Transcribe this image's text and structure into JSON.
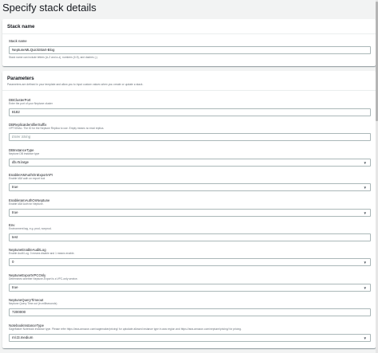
{
  "page_title": "Specify stack details",
  "stack_name_panel": {
    "title": "Stack name",
    "field_label": "Stack name",
    "value": "NeptuneMLQuickStart-Blog",
    "hint": "Stack name can include letters (A-Z and a-z), numbers (0-9), and dashes (-)."
  },
  "parameters_panel": {
    "title": "Parameters",
    "description": "Parameters are defined in your template and allow you to input custom values when you create or update a stack.",
    "fields": [
      {
        "label": "DBClusterPort",
        "desc": "Enter the port of your Neptune cluster",
        "value": "8182",
        "type": "input"
      },
      {
        "label": "DBReplicaIdentifierSuffix",
        "desc": "OPTIONAL: The ID for the Neptune Replica to use. Empty means no read replica.",
        "value": "",
        "placeholder": "Enter String",
        "type": "input"
      },
      {
        "label": "DBInstanceType",
        "desc": "Neptune DB instance type",
        "value": "db.r5.large",
        "type": "select"
      },
      {
        "label": "EnableIAMAuthOnExportAPI",
        "desc": "Enable IAM auth on export tool",
        "value": "true",
        "type": "select"
      },
      {
        "label": "EnableIamAuthOnNeptune",
        "desc": "Enable IAM Auth for Neptune.",
        "value": "true",
        "type": "select"
      },
      {
        "label": "Env",
        "desc": "Environment tag, e.g. prod, nonprod.",
        "value": "test",
        "type": "input"
      },
      {
        "label": "NeptuneEnableAuditLog",
        "desc": "Enable Audit Log. 0 means disable and 1 means enable.",
        "value": "0",
        "type": "select"
      },
      {
        "label": "NeptuneExportVPCOnly",
        "desc": "Determines whether Neptune-Export is a VPC-only service.",
        "value": "true",
        "type": "select"
      },
      {
        "label": "NeptuneQueryTimeout",
        "desc": "Neptune Query Time out (in milliseconds)",
        "value": "7200000",
        "type": "input"
      },
      {
        "label": "NotebookInstanceType",
        "desc": "SageMaker Notebook instance type. Please refer https://aws.amazon.com/sagemaker/pricing/ for uptodate allowed instance type in aws region and https://aws.amazon.com/neptune/pricing/ for pricing.",
        "value": "ml.t3.medium",
        "type": "select"
      }
    ]
  },
  "icons": {
    "caret": "caret-down-icon"
  }
}
